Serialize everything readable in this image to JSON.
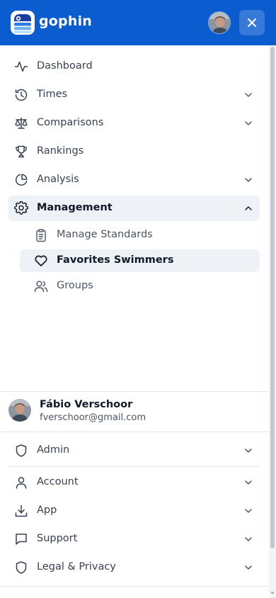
{
  "header": {
    "brand": "gophin",
    "brand_color": "#0a5ccf",
    "avatar_icon": "user-photo",
    "close_icon": "close-icon"
  },
  "nav": {
    "dashboard": "Dashboard",
    "times": "Times",
    "comparisons": "Comparisons",
    "rankings": "Rankings",
    "analysis": "Analysis",
    "management": "Management",
    "management_children": {
      "manage_standards": "Manage Standards",
      "favorites_swimmers": "Favorites Swimmers",
      "groups": "Groups"
    }
  },
  "user": {
    "name": "Fábio Verschoor",
    "email": "fverschoor@gmail.com"
  },
  "footer_nav": {
    "admin": "Admin",
    "account": "Account",
    "app": "App",
    "support": "Support",
    "legal": "Legal & Privacy"
  },
  "active_item": "Favorites Swimmers",
  "expanded_section": "Management"
}
